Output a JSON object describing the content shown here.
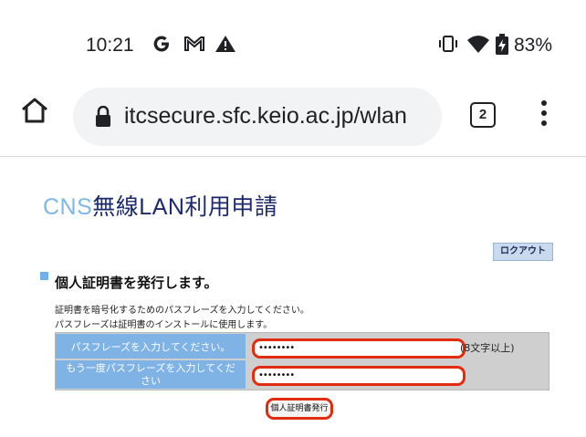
{
  "status_bar": {
    "time": "10:21",
    "battery": "83%",
    "icons": [
      "google-g-icon",
      "gmail-icon",
      "warning-icon",
      "vibrate-icon",
      "wifi-icon",
      "battery-charging-icon"
    ]
  },
  "browser": {
    "url": "itcsecure.sfc.keio.ac.jp/wlan",
    "tab_count": "2"
  },
  "page": {
    "title_cns": "CNS",
    "title_rest": "無線LAN利用申請",
    "logout_label": "ロクアウト",
    "section_title": "個人証明書を発行します。",
    "description_line1": "証明書を暗号化するためのパスフレーズを入力してください。",
    "description_line2": "パスフレーズは証明書のインストールに使用します。",
    "form": {
      "passphrase_label": "パスフレーズを入力してください。",
      "passphrase_value": "••••••••",
      "passphrase_hint": "(8文字以上)",
      "confirm_label": "もう一度パスフレーズを入力してください",
      "confirm_value": "••••••••"
    },
    "issue_button_label": "個人証明書発行"
  },
  "colors": {
    "title_cns": "#7eb7e8",
    "title_rest": "#1c2a6d",
    "label_bg": "#7fb2e5",
    "highlight": "#e22b0f"
  }
}
